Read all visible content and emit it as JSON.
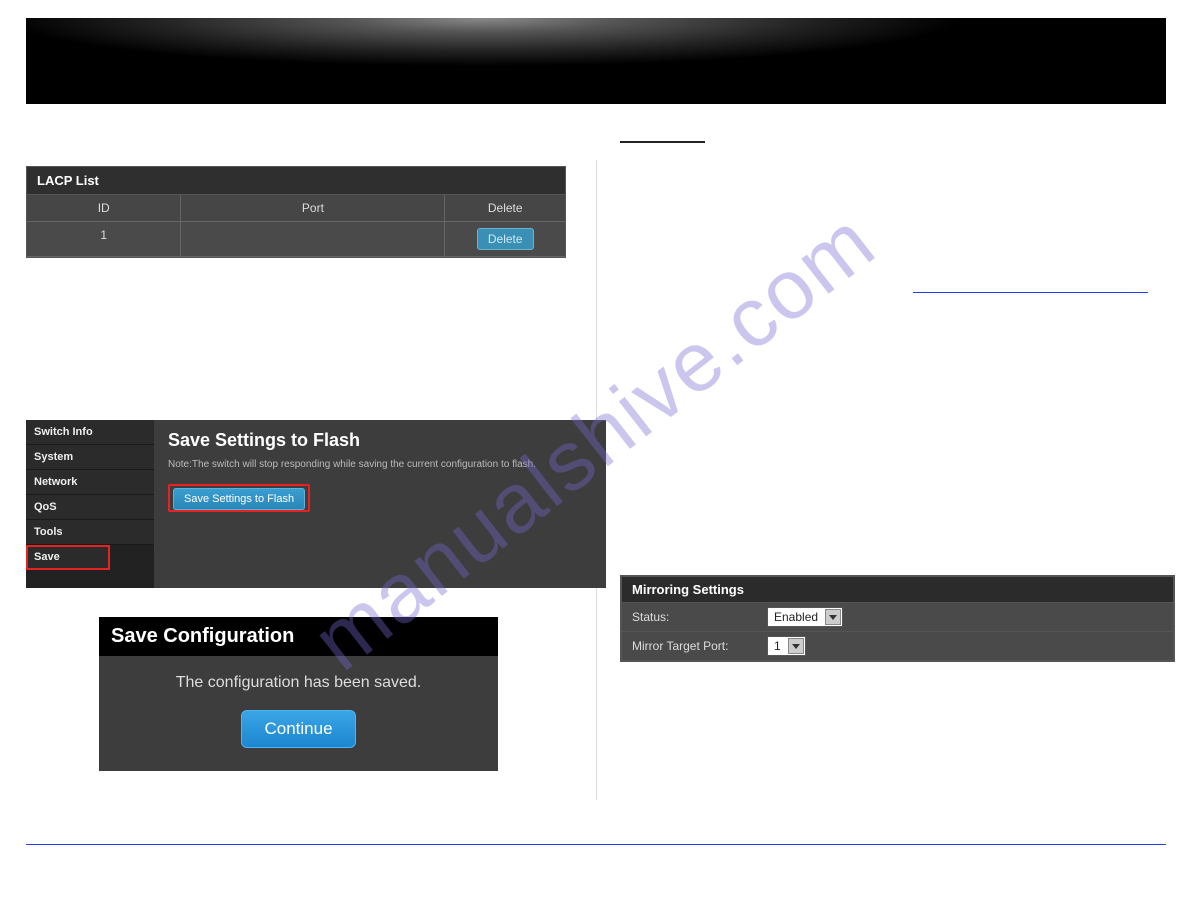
{
  "watermark": "manualshive.com",
  "lacp": {
    "title": "LACP List",
    "headers": {
      "id": "ID",
      "port": "Port",
      "del": "Delete"
    },
    "rows": [
      {
        "id": "1",
        "port": "",
        "delete_label": "Delete"
      }
    ]
  },
  "save_flash": {
    "nav": [
      "Switch Info",
      "System",
      "Network",
      "QoS",
      "Tools",
      "Save"
    ],
    "heading": "Save Settings to Flash",
    "note": "Note:The switch will stop responding while saving the current configuration to flash.",
    "button": "Save Settings to Flash"
  },
  "save_dialog": {
    "title": "Save Configuration",
    "message": "The configuration has been saved.",
    "button": "Continue"
  },
  "mirror": {
    "title": "Mirroring Settings",
    "rows": {
      "status_label": "Status:",
      "status_value": "Enabled",
      "target_label": "Mirror Target Port:",
      "target_value": "1"
    }
  }
}
